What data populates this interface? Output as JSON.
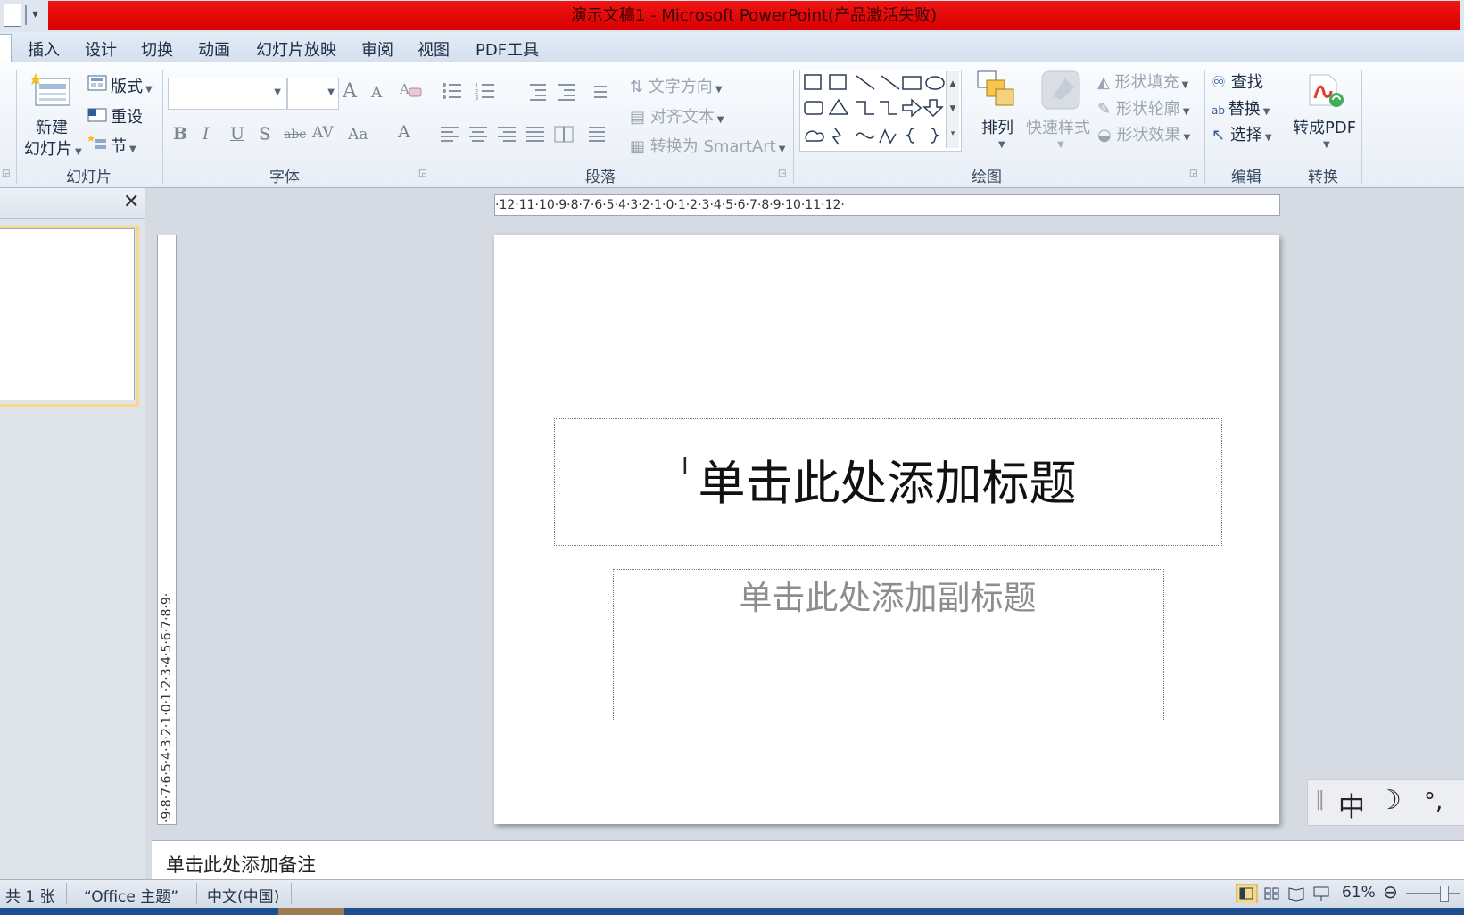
{
  "window": {
    "title": "演示文稿1 - Microsoft PowerPoint(产品激活失败)"
  },
  "tabs": [
    "插入",
    "设计",
    "切换",
    "动画",
    "幻灯片放映",
    "审阅",
    "视图",
    "PDF工具"
  ],
  "ribbon": {
    "slides_group": {
      "new_slide_line1": "新建",
      "new_slide_line2": "幻灯片",
      "layout": "版式",
      "reset": "重设",
      "section": "节",
      "label": "幻灯片"
    },
    "font_group": {
      "label": "字体",
      "grow": "A",
      "shrink": "A",
      "bold": "B",
      "italic": "I",
      "underline": "U",
      "shadow": "S",
      "strike": "abc",
      "spacing": "AV",
      "case": "Aa",
      "color": "A"
    },
    "paragraph_group": {
      "label": "段落",
      "text_direction": "文字方向",
      "align_text": "对齐文本",
      "smartart": "转换为 SmartArt"
    },
    "drawing_group": {
      "label": "绘图",
      "arrange": "排列",
      "quick_styles": "快速样式",
      "fill": "形状填充",
      "outline": "形状轮廓",
      "effects": "形状效果"
    },
    "editing_group": {
      "label": "编辑",
      "find": "查找",
      "replace": "替换",
      "select": "选择"
    },
    "convert_group": {
      "label": "转换",
      "to_pdf": "转成PDF"
    }
  },
  "ruler": {
    "horizontal": "·12·11·10·9·8·7·6·5·4·3·2·1·0·1·2·3·4·5·6·7·8·9·10·11·12·",
    "vertical": "·9·8·7·6·5·4·3·2·1·0·1·2·3·4·5·6·7·8·9·"
  },
  "slide": {
    "title_placeholder": "单击此处添加标题",
    "subtitle_placeholder": "单击此处添加副标题"
  },
  "notes": {
    "placeholder": "单击此处添加备注"
  },
  "status": {
    "slide_count": "共 1 张",
    "theme": "“Office 主题”",
    "language": "中文(中国)",
    "zoom": "61%"
  },
  "ime": {
    "mode": "中",
    "punct": "°,"
  },
  "colors": {
    "titlebar": "#e00000",
    "accent": "#d6dbe3"
  }
}
